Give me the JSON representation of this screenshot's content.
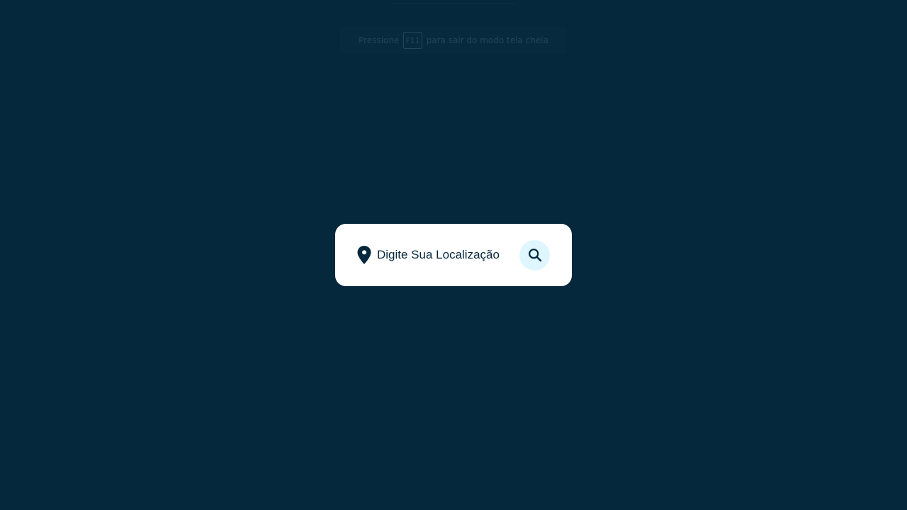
{
  "fullscreen_notice": {
    "prefix": "Pressione",
    "key": "F11",
    "suffix": "para sair do modo tela cheia"
  },
  "search": {
    "placeholder": "Digite Sua Localização",
    "value": "",
    "location_icon": "map-pin-icon",
    "button_icon": "search-icon"
  },
  "colors": {
    "background": "#06283d",
    "card": "#ffffff",
    "accent_light": "#dff6ff",
    "text": "#06283d"
  }
}
